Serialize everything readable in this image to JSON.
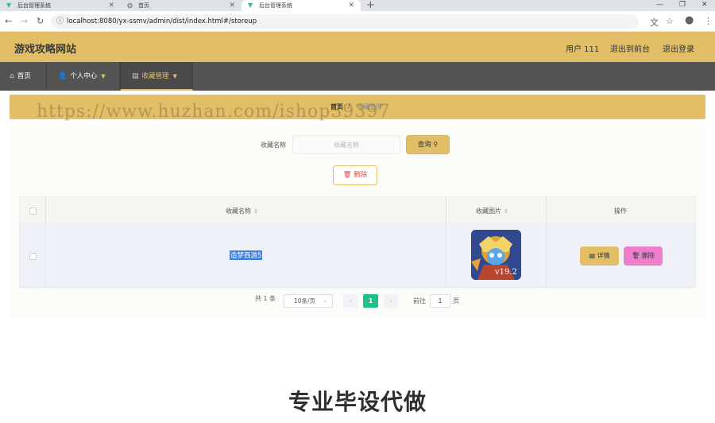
{
  "browser": {
    "tabs": [
      {
        "title": "后台管理系统",
        "icon": "vue-icon"
      },
      {
        "title": "首页",
        "icon": "globe-icon"
      },
      {
        "title": "后台管理系统",
        "icon": "vue-icon"
      }
    ],
    "url": "localhost:8080/yx-ssmv/admin/dist/index.html#/storeup"
  },
  "header": {
    "site_title": "游戏攻略网站",
    "user": "用户 111",
    "back_front": "退出到前台",
    "logout": "退出登录"
  },
  "nav": {
    "home": "首页",
    "personal": "个人中心",
    "favorites": "收藏管理"
  },
  "breadcrumb": {
    "home": "首页",
    "separator": "/",
    "current": "收藏管理"
  },
  "watermark": "https://www.huzhan.com/ishop39397",
  "search": {
    "label": "收藏名称",
    "placeholder": "收藏名称",
    "query_button": "查询"
  },
  "actions": {
    "delete_button": "删除"
  },
  "table": {
    "columns": [
      "收藏名称",
      "收藏图片",
      "操作"
    ],
    "rows": [
      {
        "name": "造梦西游5",
        "image_caption": "v19.2",
        "detail": "详情",
        "delete": "删除"
      }
    ]
  },
  "pagination": {
    "total": "共 1 条",
    "page_size": "10条/页",
    "current_page": "1",
    "goto_prefix": "前往",
    "goto_value": "1",
    "goto_suffix": "页"
  },
  "promo_text": "专业毕设代做",
  "colors": {
    "accent": "#e2bf66",
    "nav_bg": "#545454",
    "delete_pink": "#ef7ecf",
    "page_active": "#1fbf8f"
  }
}
